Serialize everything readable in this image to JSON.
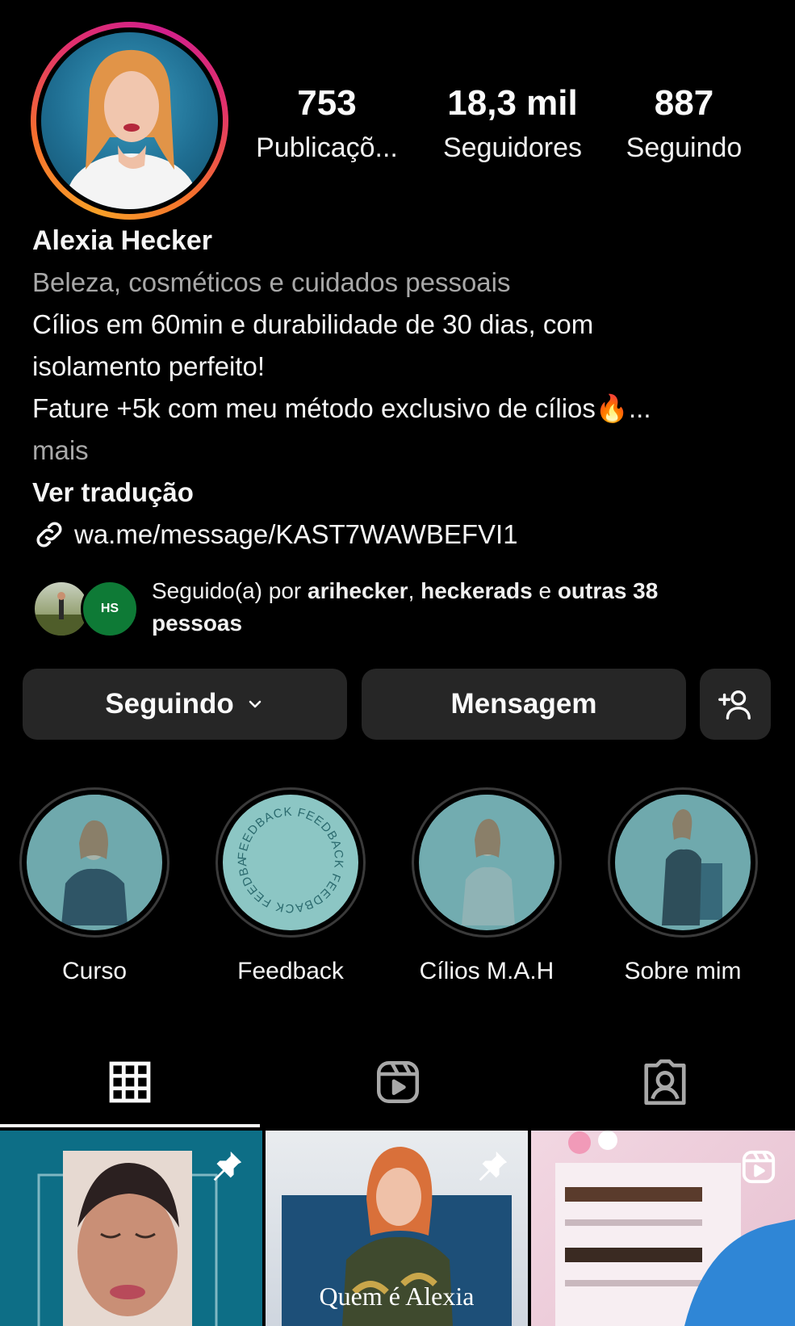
{
  "profile": {
    "stats": [
      {
        "value": "753",
        "label": "Publicaçõ..."
      },
      {
        "value": "18,3 mil",
        "label": "Seguidores"
      },
      {
        "value": "887",
        "label": "Seguindo"
      }
    ],
    "name": "Alexia Hecker",
    "category": "Beleza, cosméticos e cuidados pessoais",
    "bio_lines": [
      "Cílios em 60min e durabilidade de 30 dias, com",
      "isolamento perfeito!",
      "Fature +5k com meu método exclusivo de cílios🔥..."
    ],
    "more": "mais",
    "translate": "Ver tradução",
    "link": "wa.me/message/KAST7WAWBEFVI1"
  },
  "followed_by": {
    "prefix": "Seguido(a) por ",
    "user1": "arihecker",
    "sep": ", ",
    "user2": "heckerads",
    "and": " e ",
    "others": "outras 38",
    "people": "pessoas",
    "avatar_b_text": "HS"
  },
  "buttons": {
    "following": "Seguindo",
    "message": "Mensagem"
  },
  "highlights": [
    {
      "label": "Curso"
    },
    {
      "label": "Feedback",
      "ring_text": "FEEDBACK FEEDBACK FEEDBACK FEEDBACK "
    },
    {
      "label": "Cílios M.A.H"
    },
    {
      "label": "Sobre mim"
    }
  ],
  "grid": {
    "post2_caption": "Quem é Alexia"
  },
  "colors": {
    "background": "#000000",
    "button": "#262626",
    "secondary_text": "#a8a8a8",
    "highlight_tint": "#6fa9ad"
  },
  "icons": [
    "link-icon",
    "chevron-down-icon",
    "add-person-icon",
    "grid-icon",
    "reels-icon",
    "tagged-icon",
    "pin-icon",
    "reel-badge-icon"
  ]
}
